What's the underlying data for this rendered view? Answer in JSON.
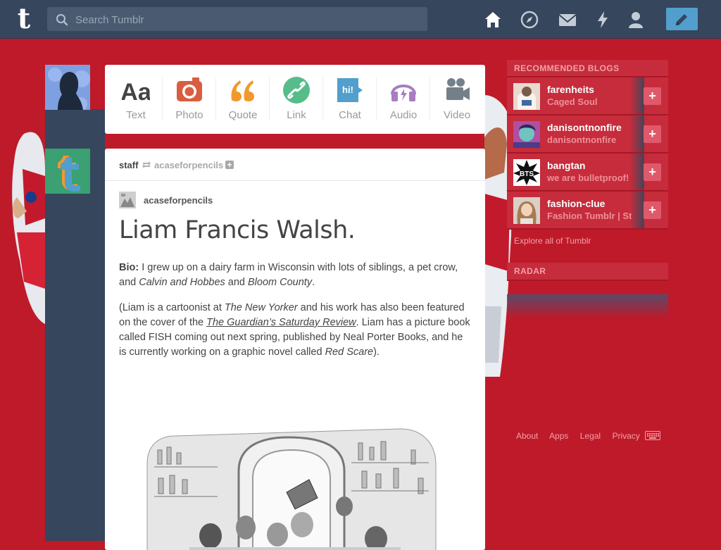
{
  "header": {
    "logo": "t",
    "search_placeholder": "Search Tumblr",
    "icons": [
      "home-icon",
      "explore-icon",
      "inbox-icon",
      "activity-icon",
      "account-icon",
      "compose-icon"
    ]
  },
  "post_types": [
    {
      "label": "Text",
      "icon": "text-icon",
      "color": "#444444"
    },
    {
      "label": "Photo",
      "icon": "camera-icon",
      "color": "#d95e40"
    },
    {
      "label": "Quote",
      "icon": "quote-icon",
      "color": "#f2992e"
    },
    {
      "label": "Link",
      "icon": "link-icon",
      "color": "#56bc8a"
    },
    {
      "label": "Chat",
      "icon": "chat-icon",
      "color": "#529ecc"
    },
    {
      "label": "Audio",
      "icon": "headphones-icon",
      "color": "#a77dc2"
    },
    {
      "label": "Video",
      "icon": "video-camera-icon",
      "color": "#748089"
    }
  ],
  "post": {
    "poster": "staff",
    "reblogged_from": "acaseforpencils",
    "source_blog": "acaseforpencils",
    "title": "Liam Francis Walsh.",
    "bio_label": "Bio:",
    "bio_text_1": " I grew up on a dairy farm in Wisconsin with lots of siblings, a pet crow, and ",
    "bio_em_1": "Calvin and Hobbes",
    "bio_text_2": " and ",
    "bio_em_2": "Bloom County",
    "bio_text_3": ".",
    "p2_text_1": "(Liam is a cartoonist at ",
    "p2_em_1": "The New Yorker",
    "p2_text_2": " and his work has also been featured on the cover of the ",
    "p2_link": "The Guardian’s Saturday Review",
    "p2_text_3": ". Liam has a picture book called FISH coming out next spring, published by Neal Porter Books, and he is currently working on a graphic novel called ",
    "p2_em_2": "Red Scare",
    "p2_text_4": ")."
  },
  "recommended": {
    "heading": "RECOMMENDED BLOGS",
    "blogs": [
      {
        "name": "farenheits",
        "subtitle": "Caged Soul"
      },
      {
        "name": "danisontnonfire",
        "subtitle": "danisontnonfire"
      },
      {
        "name": "bangtan",
        "subtitle": "we are bulletproof!"
      },
      {
        "name": "fashion-clue",
        "subtitle": "Fashion Tumblr | Str"
      }
    ],
    "explore": "Explore all of Tumblr"
  },
  "radar": {
    "heading": "RADAR"
  },
  "footer": {
    "links": [
      "About",
      "Apps",
      "Legal",
      "Privacy"
    ]
  },
  "colors": {
    "background": "#be1a2a",
    "header": "#36465d",
    "accent": "#529ecc"
  }
}
